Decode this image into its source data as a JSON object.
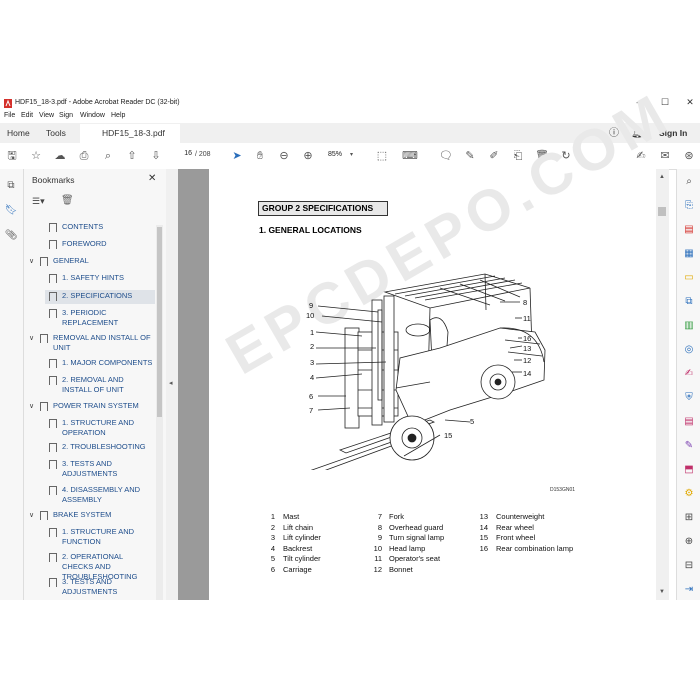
{
  "window": {
    "title": "HDF15_18-3.pdf - Adobe Acrobat Reader DC (32-bit)",
    "minimize": "—",
    "maximize": "☐",
    "close": "✕"
  },
  "menu": [
    "File",
    "Edit",
    "View",
    "Sign",
    "Window",
    "Help"
  ],
  "tabs": {
    "home": "Home",
    "tools": "Tools",
    "document": "HDF15_18-3.pdf",
    "sign_in": "Sign In"
  },
  "toolbar": {
    "page_current": "16",
    "page_total": "/ 208",
    "zoom": "85%"
  },
  "bookmarks": {
    "header": "Bookmarks",
    "items": [
      {
        "label": "CONTENTS",
        "level": 1
      },
      {
        "label": "FOREWORD",
        "level": 1
      },
      {
        "label": "GENERAL",
        "level": 0,
        "expanded": true
      },
      {
        "label": "1. SAFETY HINTS",
        "level": 1
      },
      {
        "label": "2. SPECIFICATIONS",
        "level": 1,
        "selected": true
      },
      {
        "label": "3. PERIODIC REPLACEMENT",
        "level": 1
      },
      {
        "label": "REMOVAL AND INSTALL OF UNIT",
        "level": 0,
        "expanded": true
      },
      {
        "label": "1. MAJOR COMPONENTS",
        "level": 1
      },
      {
        "label": "2. REMOVAL AND INSTALL OF UNIT",
        "level": 1
      },
      {
        "label": "POWER TRAIN SYSTEM",
        "level": 0,
        "expanded": true
      },
      {
        "label": "1. STRUCTURE AND OPERATION",
        "level": 1
      },
      {
        "label": "2. TROUBLESHOOTING",
        "level": 1
      },
      {
        "label": "3. TESTS AND ADJUSTMENTS",
        "level": 1
      },
      {
        "label": "4. DISASSEMBLY AND ASSEMBLY",
        "level": 1
      },
      {
        "label": "BRAKE SYSTEM",
        "level": 0,
        "expanded": true
      },
      {
        "label": "1. STRUCTURE AND FUNCTION",
        "level": 1
      },
      {
        "label": "2. OPERATIONAL CHECKS AND TROUBLESHOOTING",
        "level": 1
      },
      {
        "label": "3. TESTS AND ADJUSTMENTS",
        "level": 1
      }
    ]
  },
  "document": {
    "group_title": "GROUP 2  SPECIFICATIONS",
    "section_title": "1. GENERAL LOCATIONS",
    "watermark": "EPCDEPO.COM",
    "figure_code": "D153GN01",
    "callouts": [
      "9",
      "10",
      "1",
      "2",
      "3",
      "4",
      "6",
      "7",
      "8",
      "11",
      "16",
      "13",
      "12",
      "14",
      "5",
      "15"
    ],
    "legend": [
      {
        "num": "1",
        "text": "Mast"
      },
      {
        "num": "2",
        "text": "Lift chain"
      },
      {
        "num": "3",
        "text": "Lift cylinder"
      },
      {
        "num": "4",
        "text": "Backrest"
      },
      {
        "num": "5",
        "text": "Tilt cylinder"
      },
      {
        "num": "6",
        "text": "Carriage"
      },
      {
        "num": "7",
        "text": "Fork"
      },
      {
        "num": "8",
        "text": "Overhead guard"
      },
      {
        "num": "9",
        "text": "Turn signal lamp"
      },
      {
        "num": "10",
        "text": "Head lamp"
      },
      {
        "num": "11",
        "text": "Operator's seat"
      },
      {
        "num": "12",
        "text": "Bonnet"
      },
      {
        "num": "13",
        "text": "Counterweight"
      },
      {
        "num": "14",
        "text": "Rear wheel"
      },
      {
        "num": "15",
        "text": "Front wheel"
      },
      {
        "num": "16",
        "text": "Rear combination lamp"
      }
    ]
  }
}
